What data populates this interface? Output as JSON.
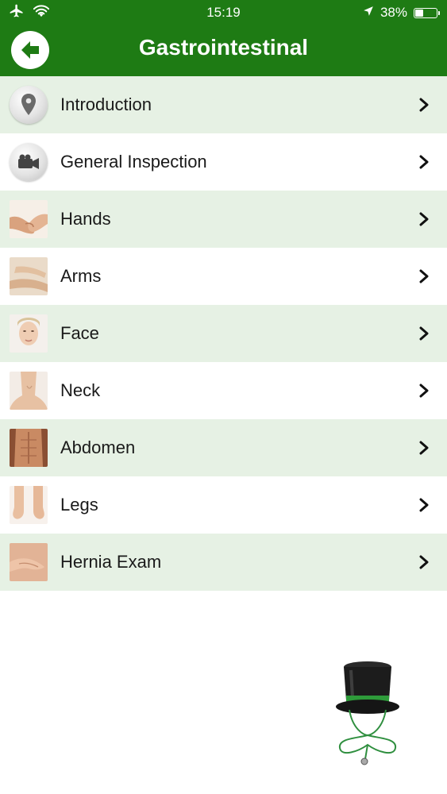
{
  "status_bar": {
    "time": "15:19",
    "battery_percent": "38%",
    "battery_level": 0.38,
    "icons": [
      "airplane-icon",
      "wifi-icon",
      "location-arrow-icon",
      "battery-icon"
    ]
  },
  "nav": {
    "title": "Gastrointestinal",
    "back_icon": "arrow-left-icon"
  },
  "colors": {
    "header_green": "#1e7b14",
    "row_alt": "#e6f1e4",
    "row": "#ffffff"
  },
  "menu": {
    "items": [
      {
        "label": "Introduction",
        "icon": "map-pin-icon"
      },
      {
        "label": "General Inspection",
        "icon": "video-camera-icon"
      },
      {
        "label": "Hands",
        "icon": "hands-photo"
      },
      {
        "label": "Arms",
        "icon": "arms-photo"
      },
      {
        "label": "Face",
        "icon": "face-photo"
      },
      {
        "label": "Neck",
        "icon": "neck-photo"
      },
      {
        "label": "Abdomen",
        "icon": "abdomen-photo"
      },
      {
        "label": "Legs",
        "icon": "legs-photo"
      },
      {
        "label": "Hernia Exam",
        "icon": "hernia-photo"
      }
    ],
    "chevron_icon": "chevron-right-icon"
  },
  "mascot": "top-hat-stethoscope-logo"
}
